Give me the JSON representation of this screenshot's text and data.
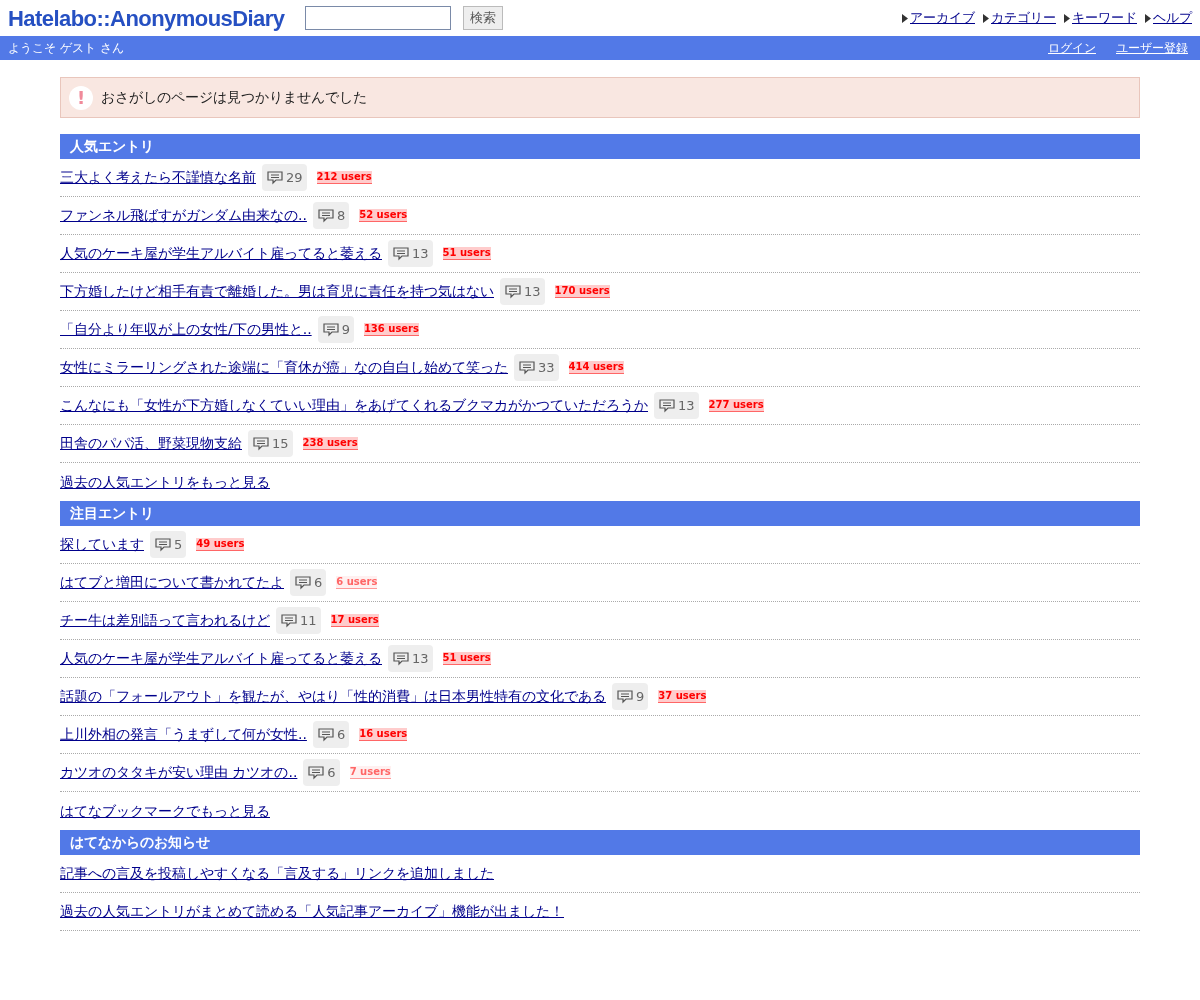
{
  "header": {
    "logo": "Hatelabo::AnonymousDiary",
    "search": {
      "button": "検索"
    },
    "nav": [
      "アーカイブ",
      "カテゴリー",
      "キーワード",
      "ヘルプ"
    ]
  },
  "subbar": {
    "welcome": "ようこそ ゲスト さん",
    "links": [
      "ログイン",
      "ユーザー登録"
    ]
  },
  "alert": {
    "icon": "!",
    "message": "おさがしのページは見つかりませんでした"
  },
  "sections": [
    {
      "title": "人気エントリ",
      "entries": [
        {
          "title": "三大よく考えたら不謹慎な名前",
          "comments": "29",
          "users": "212 users",
          "kind": "hot"
        },
        {
          "title": "ファンネル飛ばすがガンダム由来なの..",
          "comments": "8",
          "users": "52 users",
          "kind": "hot"
        },
        {
          "title": "人気のケーキ屋が学生アルバイト雇ってると萎える",
          "comments": "13",
          "users": "51 users",
          "kind": "hot"
        },
        {
          "title": "下方婚したけど相手有責で離婚した。男は育児に責任を持つ気はない",
          "comments": "13",
          "users": "170 users",
          "kind": "hot"
        },
        {
          "title": "「自分より年収が上の女性/下の男性と..",
          "comments": "9",
          "users": "136 users",
          "kind": "hot"
        },
        {
          "title": "女性にミラーリングされた途端に「育休が癌」なの自白し始めて笑った",
          "comments": "33",
          "users": "414 users",
          "kind": "hot"
        },
        {
          "title": "こんなにも「女性が下方婚しなくていい理由」をあげてくれるブクマカがかつていただろうか",
          "comments": "13",
          "users": "277 users",
          "kind": "hot"
        },
        {
          "title": "田舎のパパ活、野菜現物支給",
          "comments": "15",
          "users": "238 users",
          "kind": "hot"
        }
      ],
      "more": "過去の人気エントリをもっと見る"
    },
    {
      "title": "注目エントリ",
      "entries": [
        {
          "title": "探しています",
          "comments": "5",
          "users": "49 users",
          "kind": "hot"
        },
        {
          "title": "はてブと増田について書かれてたよ",
          "comments": "6",
          "users": "6 users",
          "kind": "few"
        },
        {
          "title": "チー牛は差別語って言われるけど",
          "comments": "11",
          "users": "17 users",
          "kind": "hot"
        },
        {
          "title": "人気のケーキ屋が学生アルバイト雇ってると萎える",
          "comments": "13",
          "users": "51 users",
          "kind": "hot"
        },
        {
          "title": "話題の「フォールアウト」を観たが、やはり「性的消費」は日本男性特有の文化である",
          "comments": "9",
          "users": "37 users",
          "kind": "hot"
        },
        {
          "title": "上川外相の発言「うまずして何が女性..",
          "comments": "6",
          "users": "16 users",
          "kind": "hot"
        },
        {
          "title": "カツオのタタキが安い理由 カツオの..",
          "comments": "6",
          "users": "7 users",
          "kind": "few"
        }
      ],
      "more": "はてなブックマークでもっと見る"
    },
    {
      "title": "はてなからのお知らせ",
      "entries": [
        {
          "title": "記事への言及を投稿しやすくなる「言及する」リンクを追加しました"
        },
        {
          "title": "過去の人気エントリがまとめて読める「人気記事アーカイブ」機能が出ました！"
        }
      ]
    }
  ]
}
